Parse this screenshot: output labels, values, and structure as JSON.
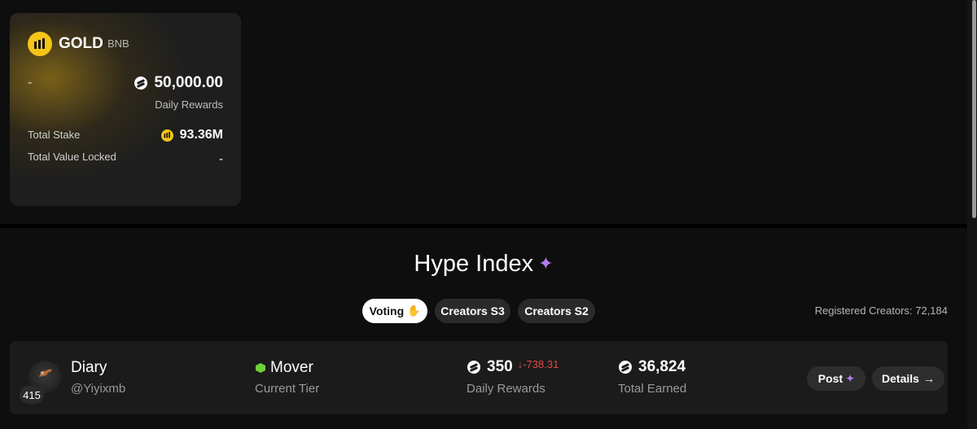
{
  "pool_card": {
    "name": "GOLD",
    "chain": "BNB",
    "left_value": "-",
    "daily_rewards_value": "50,000.00",
    "daily_rewards_label": "Daily Rewards",
    "total_stake_label": "Total Stake",
    "total_stake_value": "93.36M",
    "tvl_label": "Total Value Locked",
    "tvl_value": "-",
    "accent_color": "#f5c518"
  },
  "hype_index": {
    "title": "Hype Index",
    "title_icon": "sparkle-icon",
    "tabs": [
      {
        "label": "Voting",
        "icon": "hand-icon",
        "active": true
      },
      {
        "label": "Creators S3",
        "active": false
      },
      {
        "label": "Creators S2",
        "active": false
      }
    ],
    "registered_creators": "Registered Creators: 72,184"
  },
  "creator": {
    "rank": "415",
    "name": "Diary",
    "handle": "@Yiyixmb",
    "tier": "Mover",
    "tier_label": "Current Tier",
    "daily_rewards": "350",
    "daily_change": "-738.31",
    "daily_label": "Daily Rewards",
    "total_earned": "36,824",
    "earned_label": "Total Earned",
    "post_label": "Post",
    "details_label": "Details"
  },
  "colors": {
    "background": "#0e0e0e",
    "negative": "#e84848",
    "sparkle": "#b57cf5",
    "tier_green": "#6fd03a"
  }
}
